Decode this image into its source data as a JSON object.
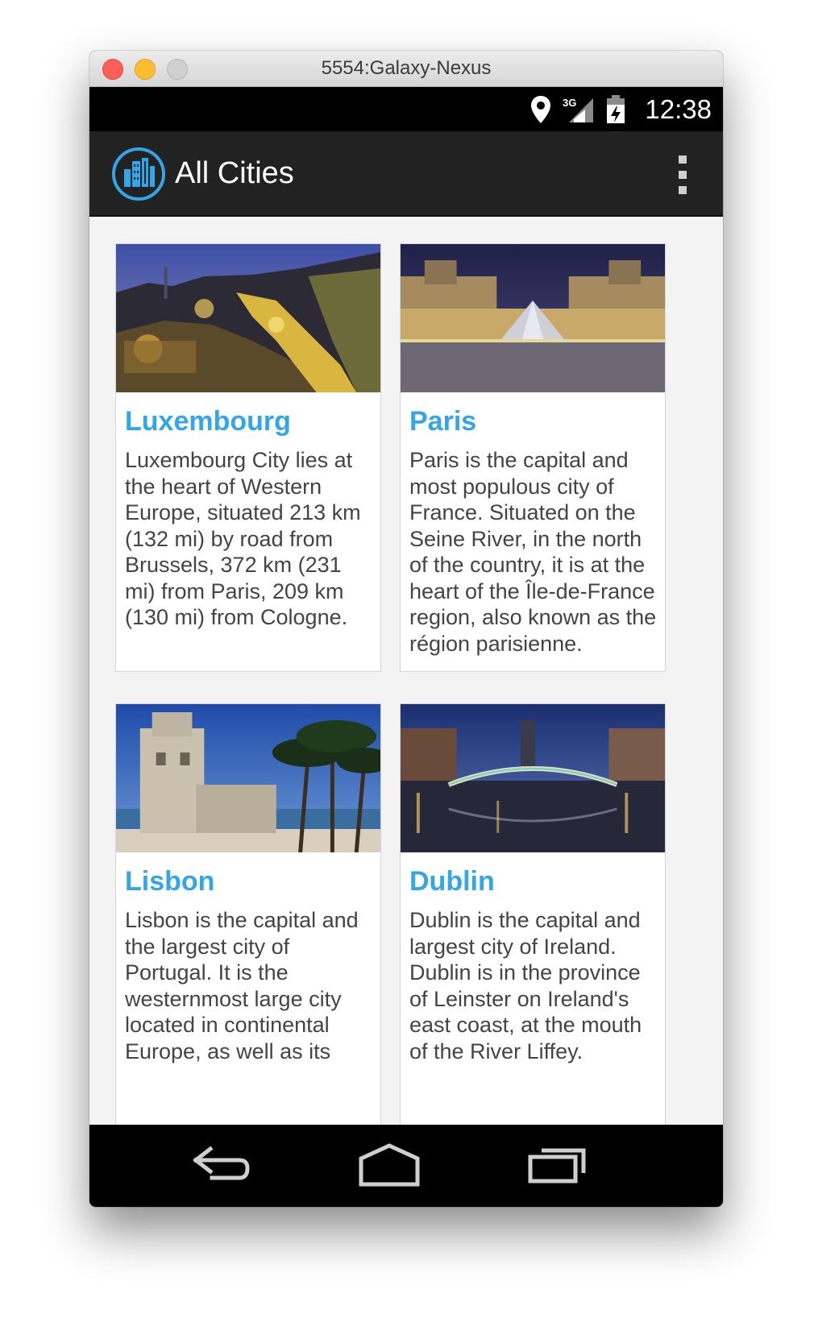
{
  "window": {
    "title": "5554:Galaxy-Nexus"
  },
  "status_bar": {
    "icons": [
      "location-icon",
      "signal-3g-icon",
      "battery-icon"
    ],
    "network_label": "3G",
    "time": "12:38"
  },
  "action_bar": {
    "app_icon": "city-buildings-icon",
    "title": "All Cities",
    "overflow_icon": "overflow-menu-icon"
  },
  "cities": [
    {
      "name": "Luxembourg",
      "description": "Luxembourg City lies at the heart of Western Europe, situated 213 km (132 mi) by road from Brussels, 372 km (231 mi) from Paris, 209 km (130 mi) from Cologne."
    },
    {
      "name": "Paris",
      "description": "Paris is the capital and most populous city of France. Situated on the Seine River, in the north of the country, it is at the heart of the Île-de-France region, also known as the région parisienne."
    },
    {
      "name": "Lisbon",
      "description": "Lisbon is the capital and the largest city of Portugal. It is the westernmost large city located in continental Europe, as well as its"
    },
    {
      "name": "Dublin",
      "description": "Dublin is the capital and largest city of Ireland. Dublin is in the province of Leinster on Ireland's east coast, at the mouth of the River Liffey."
    }
  ],
  "nav_bar": {
    "icons": [
      "back-icon",
      "home-icon",
      "recent-apps-icon"
    ]
  },
  "colors": {
    "accent": "#33a6e8",
    "action_bar": "#222222",
    "content_background": "#f3f3f3"
  }
}
